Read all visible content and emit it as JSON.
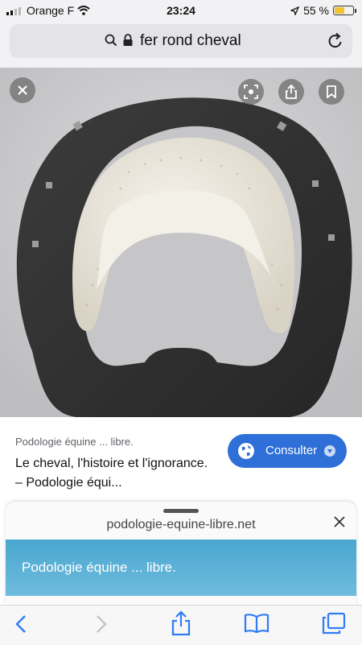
{
  "status_bar": {
    "carrier": "Orange F",
    "time": "23:24",
    "battery_percent": "55 %",
    "battery_level": 0.55,
    "signal_bars": 2
  },
  "url_bar": {
    "text": "fer rond cheval",
    "icons": [
      "search-icon",
      "lock-icon",
      "reload-icon"
    ]
  },
  "image_viewer": {
    "overlay_buttons": [
      "close-icon",
      "lens-icon",
      "share-icon",
      "bookmark-icon"
    ]
  },
  "result": {
    "source": "Podologie équine ... libre.",
    "title": "Le cheval, l'histoire et l'ignorance. – Podologie équi...",
    "consult_label": "Consulter"
  },
  "preview_sheet": {
    "domain": "podologie-equine-libre.net",
    "banner_text": "Podologie équine ... libre."
  },
  "toolbar": {
    "items": [
      "back-icon",
      "forward-icon",
      "share-icon",
      "bookmarks-icon",
      "tabs-icon"
    ]
  },
  "colors": {
    "accent": "#2f6fd8",
    "link_blue": "#1a73e8",
    "battery": "#f2c233",
    "banner": "#4aa6cf"
  }
}
